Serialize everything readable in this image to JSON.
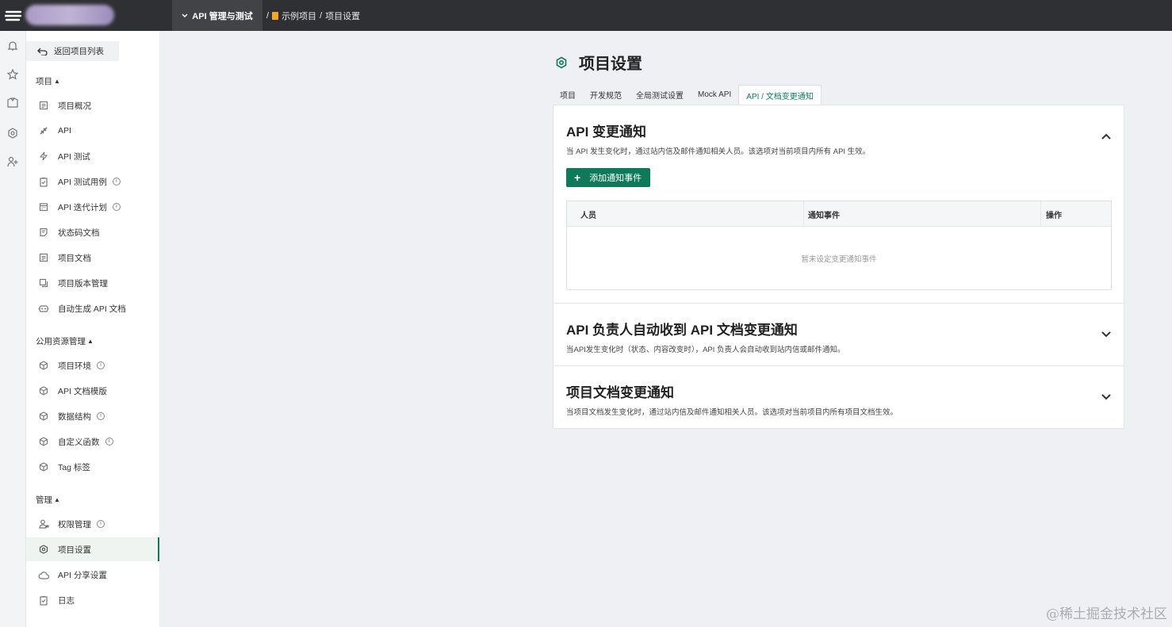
{
  "topbar": {
    "module": "API 管理与测试",
    "separator": "/",
    "project": "示例项目",
    "separator2": "/",
    "current": "项目设置"
  },
  "rail": {
    "icons": [
      "bell-icon",
      "star-icon",
      "shirt-icon",
      "gear-icon",
      "add-user-icon"
    ]
  },
  "sidebar": {
    "back_label": "返回项目列表",
    "groups": [
      {
        "title": "项目",
        "items": [
          {
            "label": "项目概况",
            "icon": "doc-icon"
          },
          {
            "label": "API",
            "icon": "link-icon"
          },
          {
            "label": "API 测试",
            "icon": "bolt-icon"
          },
          {
            "label": "API 测试用例",
            "icon": "clipboard-icon",
            "info": true
          },
          {
            "label": "API 迭代计划",
            "icon": "calendar-icon",
            "info": true
          },
          {
            "label": "状态码文档",
            "icon": "code-doc-icon"
          },
          {
            "label": "项目文档",
            "icon": "doc-icon"
          },
          {
            "label": "项目版本管理",
            "icon": "version-icon"
          },
          {
            "label": "自动生成 API 文档",
            "icon": "robot-icon"
          }
        ]
      },
      {
        "title": "公用资源管理",
        "items": [
          {
            "label": "项目环境",
            "icon": "cube-icon",
            "info": true
          },
          {
            "label": "API 文档模版",
            "icon": "cube-icon"
          },
          {
            "label": "数据结构",
            "icon": "cube-icon",
            "info": true
          },
          {
            "label": "自定义函数",
            "icon": "cube-icon",
            "info": true
          },
          {
            "label": "Tag 标签",
            "icon": "cube-icon"
          }
        ]
      },
      {
        "title": "管理",
        "items": [
          {
            "label": "权限管理",
            "icon": "user-lock-icon",
            "info": true
          },
          {
            "label": "项目设置",
            "icon": "gear-icon",
            "active": true
          },
          {
            "label": "API 分享设置",
            "icon": "cloud-icon"
          },
          {
            "label": "日志",
            "icon": "clipboard-icon"
          }
        ]
      }
    ]
  },
  "main": {
    "title": "项目设置",
    "tabs": [
      "项目",
      "开发规范",
      "全局测试设置",
      "Mock API",
      "API / 文档变更通知"
    ],
    "active_tab": 4,
    "section1": {
      "title": "API 变更通知",
      "desc": "当 API 发生变化时，通过站内信及邮件通知相关人员。该选项对当前项目内所有 API 生效。",
      "add_label": "添加通知事件",
      "columns": [
        "人员",
        "通知事件",
        "操作"
      ],
      "empty": "暂未设定变更通知事件"
    },
    "section2": {
      "title": "API 负责人自动收到 API 文档变更通知",
      "desc": "当API发生变化时（状态、内容改变时），API 负责人会自动收到站内信或邮件通知。"
    },
    "section3": {
      "title": "项目文档变更通知",
      "desc": "当项目文档发生变化时，通过站内信及邮件通知相关人员。该选项对当前项目内所有项目文档生效。"
    }
  },
  "watermark": "@稀土掘金技术社区",
  "colors": {
    "accent": "#0e7a5a",
    "topbar": "#2f3033"
  }
}
